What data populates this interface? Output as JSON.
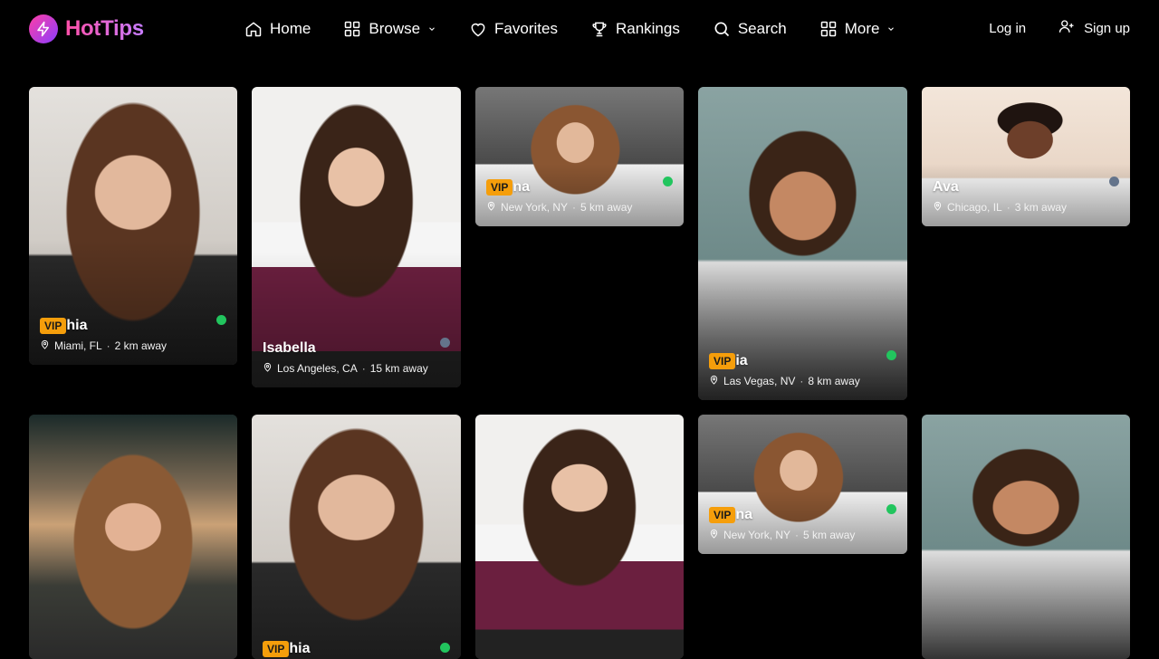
{
  "brand": {
    "name": "HotTips"
  },
  "nav": [
    {
      "label": "Home",
      "icon": "home-icon"
    },
    {
      "label": "Browse",
      "icon": "grid-icon",
      "has_dropdown": true
    },
    {
      "label": "Favorites",
      "icon": "heart-icon"
    },
    {
      "label": "Rankings",
      "icon": "trophy-icon"
    },
    {
      "label": "Search",
      "icon": "search-icon"
    },
    {
      "label": "More",
      "icon": "grid-icon",
      "has_dropdown": true
    }
  ],
  "auth": {
    "login": "Log in",
    "signup": "Sign up"
  },
  "colors": {
    "vip": "#f59e0b",
    "online": "#22c55e",
    "offline": "#64748b",
    "brand_start": "#ff3ea5",
    "brand_end": "#8b3dff"
  },
  "cards": [
    {
      "name": "hia",
      "vip": true,
      "location": "Miami, FL",
      "distance": "2 km away",
      "status": "online"
    },
    {
      "name": "Isabella",
      "vip": false,
      "location": "Los Angeles, CA",
      "distance": "15 km away",
      "status": "offline"
    },
    {
      "name": "na",
      "vip": true,
      "location": "New York, NY",
      "distance": "5 km away",
      "status": "online"
    },
    {
      "name": "ia",
      "vip": true,
      "location": "Las Vegas, NV",
      "distance": "8 km away",
      "status": "online"
    },
    {
      "name": "Ava",
      "vip": false,
      "location": "Chicago, IL",
      "distance": "3 km away",
      "status": "offline"
    },
    {
      "name": "",
      "vip": false,
      "location": "",
      "distance": "",
      "status": ""
    },
    {
      "name": "hia",
      "vip": true,
      "location": "",
      "distance": "",
      "status": "online"
    },
    {
      "name": "",
      "vip": false,
      "location": "",
      "distance": "",
      "status": ""
    },
    {
      "name": "na",
      "vip": true,
      "location": "New York, NY",
      "distance": "5 km away",
      "status": "online"
    },
    {
      "name": "",
      "vip": false,
      "location": "",
      "distance": "",
      "status": ""
    }
  ],
  "vip_label": "VIP",
  "dot_separator": "·"
}
